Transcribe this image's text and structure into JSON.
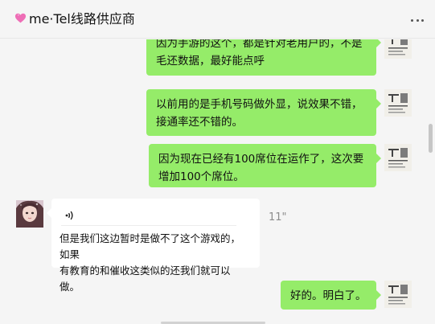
{
  "header": {
    "title": "me·Tel线路供应商",
    "heart_icon": "pink-heart-icon",
    "more_icon": "more-dots-icon"
  },
  "messages": [
    {
      "direction": "outgoing",
      "lines": [
        "因为手游的这个，都是针对老用户的，不是",
        "毛还数据，最好能点呼"
      ]
    },
    {
      "direction": "outgoing",
      "lines": [
        "以前用的是手机号码做外显，说效果不错，",
        "接通率还不错的。"
      ]
    },
    {
      "direction": "outgoing",
      "lines": [
        "因为现在已经有100席位在运作了，这次要",
        "增加100个席位。"
      ]
    },
    {
      "direction": "incoming",
      "type": "voice",
      "duration": "11\"",
      "transcript": [
        "但是我们这边暂时是做不了这个游戏的，如果",
        "有教育的和催收这类似的还我们就可以做。"
      ]
    },
    {
      "direction": "outgoing",
      "lines": [
        "好的。明白了。"
      ]
    }
  ],
  "colors": {
    "outgoing_bubble": "#95ec69",
    "incoming_bubble": "#ffffff",
    "background": "#f5f5f5"
  }
}
